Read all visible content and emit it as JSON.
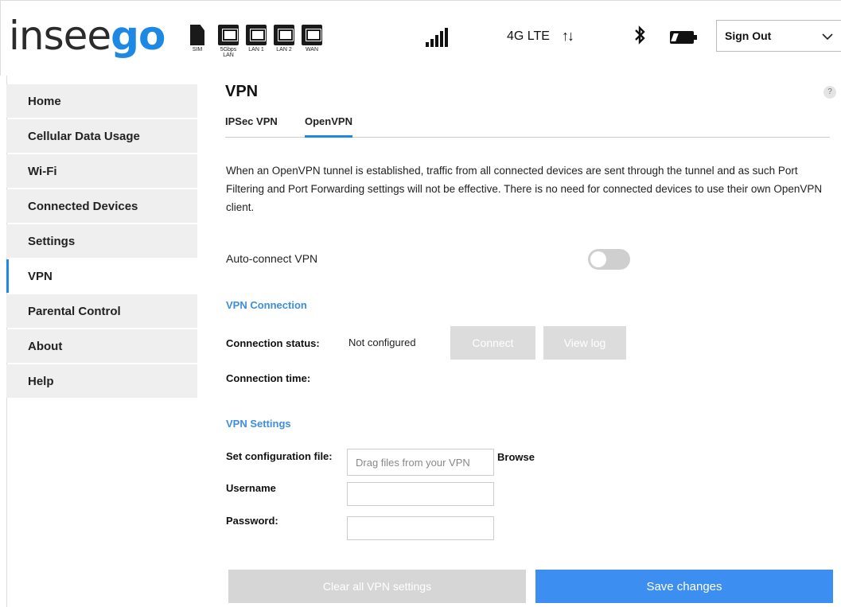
{
  "header": {
    "logo_prefix": "insee",
    "logo_suffix": "go",
    "ports": [
      {
        "label": "SIM",
        "icon": "sim-card-icon"
      },
      {
        "label": "5Gbps LAN",
        "icon": "ethernet-port-icon"
      },
      {
        "label": "LAN 1",
        "icon": "ethernet-port-icon"
      },
      {
        "label": "LAN 2",
        "icon": "ethernet-port-icon"
      },
      {
        "label": "WAN",
        "icon": "ethernet-port-icon"
      }
    ],
    "signal_icon": "signal-bars-icon",
    "network_type": "4G LTE",
    "data_arrows": "↑↓",
    "bluetooth_icon": "bluetooth-icon",
    "bluetooth_glyph": "✱",
    "battery_icon": "battery-charging-icon",
    "account_select": "Sign Out",
    "chevron": "⌵"
  },
  "sidebar": {
    "items": [
      {
        "label": "Home",
        "active": false
      },
      {
        "label": "Cellular Data Usage",
        "active": false
      },
      {
        "label": "Wi-Fi",
        "active": false
      },
      {
        "label": "Connected Devices",
        "active": false
      },
      {
        "label": "Settings",
        "active": false
      },
      {
        "label": "VPN",
        "active": true
      },
      {
        "label": "Parental Control",
        "active": false
      },
      {
        "label": "About",
        "active": false
      },
      {
        "label": "Help",
        "active": false
      }
    ]
  },
  "main": {
    "title": "VPN",
    "help_glyph": "?",
    "tabs": [
      {
        "label": "IPSec VPN",
        "active": false
      },
      {
        "label": "OpenVPN",
        "active": true
      }
    ],
    "description": "When an OpenVPN tunnel is established, traffic from all connected devices are sent through the tunnel and as such Port Filtering and Port Forwarding settings will not be effective. There is no need for connected devices to use their own OpenVPN client.",
    "auto_connect_label": "Auto-connect VPN",
    "auto_connect_enabled": false,
    "connection_section": "VPN Connection",
    "connection_status_label": "Connection status:",
    "connection_status_value": "Not configured",
    "connect_button": "Connect",
    "view_log_button": "View log",
    "connection_time_label": "Connection time:",
    "settings_section": "VPN Settings",
    "config_file_label": "Set configuration file:",
    "config_file_placeholder": "Drag files from your VPN",
    "browse_label": "Browse",
    "username_label": "Username",
    "username_value": "",
    "password_label": "Password:",
    "password_value": "",
    "clear_button": "Clear all VPN settings",
    "save_button": "Save changes"
  },
  "colors": {
    "accent": "#1e88e5",
    "section_title": "#3d8ede",
    "save_button": "#3c8ff0",
    "disabled_button": "#dcdcdc",
    "sidebar_bg": "#efefef"
  }
}
